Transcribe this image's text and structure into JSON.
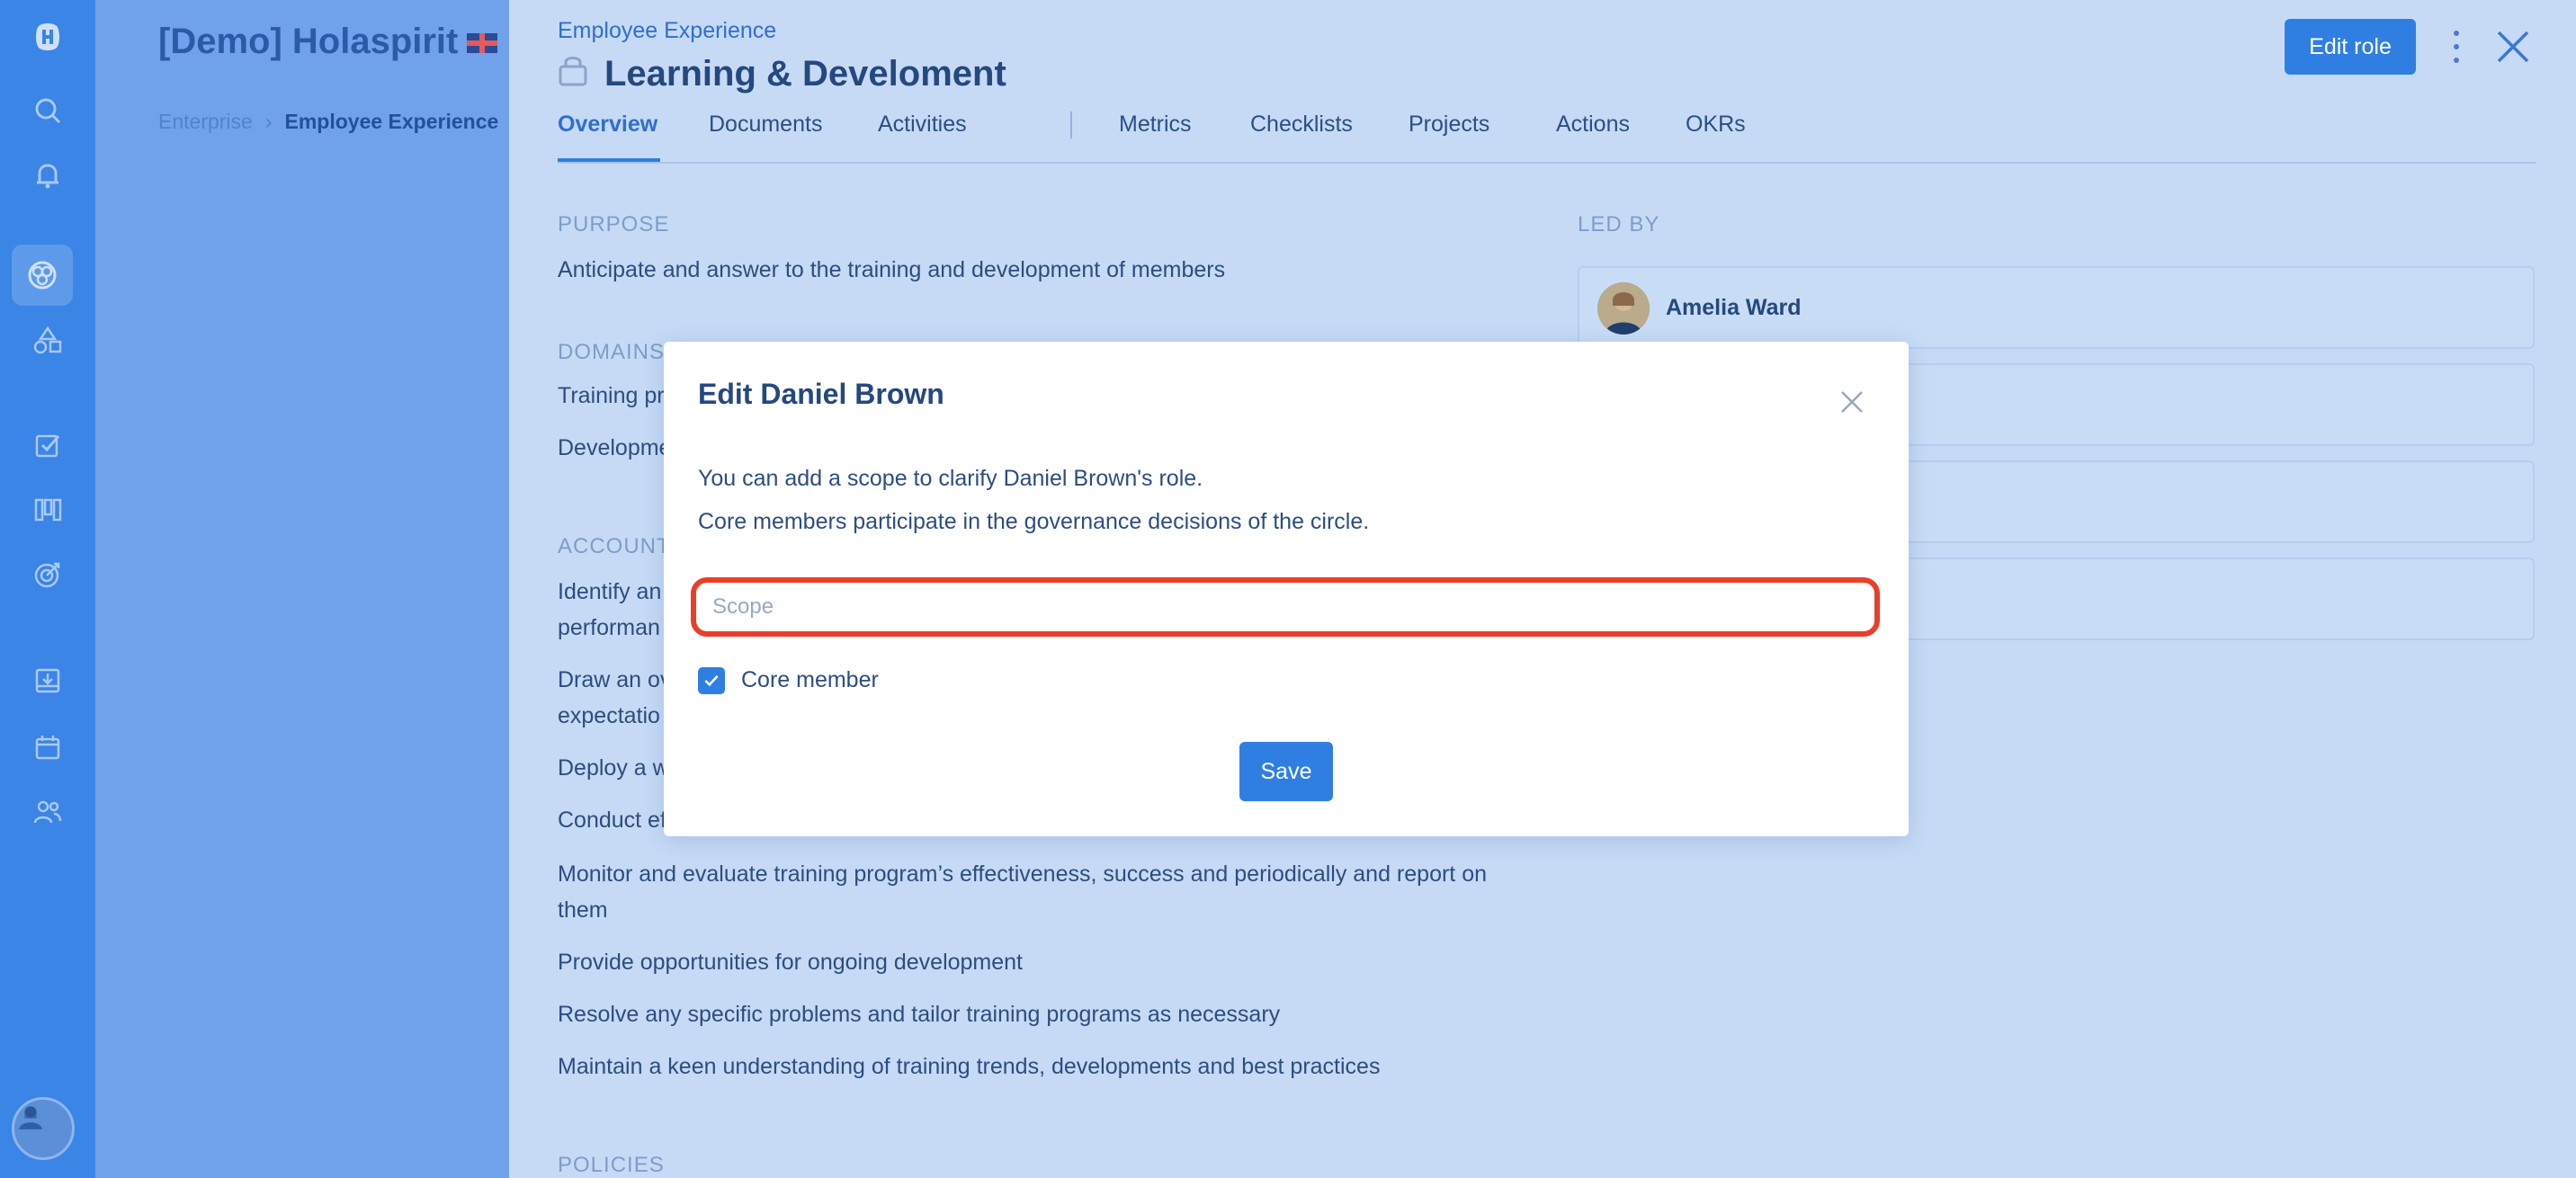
{
  "sidebar": {
    "icons": [
      "logo-icon",
      "search-icon",
      "bell-icon",
      "circles-icon",
      "roles-icon",
      "tasks-icon",
      "board-icon",
      "target-icon",
      "inbox-icon",
      "calendar-icon",
      "people-icon"
    ]
  },
  "org": {
    "title": "[Demo] Holaspirit",
    "breadcrumb": [
      "Enterprise",
      "Employee Experience"
    ]
  },
  "role": {
    "parent": "Employee Experience",
    "title": "Learning & Develoment",
    "edit_label": "Edit role"
  },
  "tabs": [
    "Overview",
    "Documents",
    "Activities",
    "Metrics",
    "Checklists",
    "Projects",
    "Actions",
    "OKRs"
  ],
  "overview": {
    "purpose_label": "PURPOSE",
    "purpose_text": "Anticipate and answer to the training and development of members",
    "domains_label": "DOMAINS",
    "domains": [
      "Training pr",
      "Developme"
    ],
    "accountabilities_label": "ACCOUNT",
    "accountabilities": [
      "Identify an",
      "performan",
      "Draw an ov",
      "expectatio",
      "Deploy a w",
      "Conduct ef",
      "Monitor and evaluate training program’s effectiveness, success and periodically and report on",
      "them",
      "Provide opportunities for ongoing development",
      "Resolve any specific problems and tailor training programs as necessary",
      "Maintain a keen understanding of training trends, developments and best practices"
    ],
    "policies_label": "POLICIES",
    "led_by_label": "LED BY",
    "leaders": [
      "Amelia Ward"
    ]
  },
  "modal": {
    "title": "Edit Daniel Brown",
    "line1": "You can add a scope to clarify Daniel Brown's role.",
    "line2": "Core members participate in the governance decisions of the circle.",
    "scope_placeholder": "Scope",
    "scope_value": "",
    "core_member_label": "Core member",
    "core_member_checked": true,
    "save_label": "Save"
  },
  "colors": {
    "accent": "#2f7fe2",
    "highlight": "#e8402a",
    "rail": "#3a85e6"
  }
}
